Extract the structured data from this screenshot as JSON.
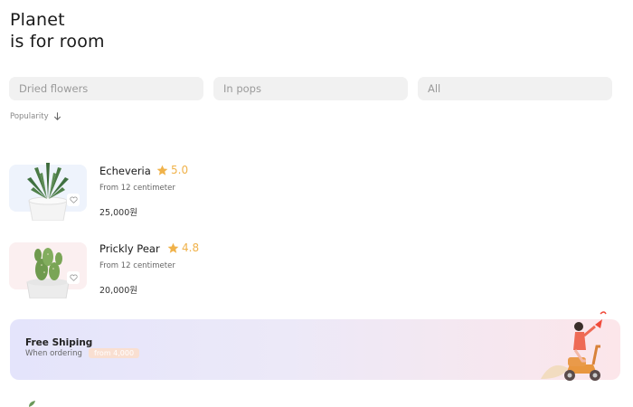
{
  "header": {
    "title_line1": "Planet",
    "title_line2": "is for room"
  },
  "filters": [
    {
      "label": "Dried flowers"
    },
    {
      "label": "In pops"
    },
    {
      "label": "All"
    }
  ],
  "sort": {
    "label": "Popularity",
    "icon": "arrow-down-icon"
  },
  "products": [
    {
      "name": "Echeveria",
      "rating": "5.0",
      "size": "From 12 centimeter",
      "price": "25,000원",
      "thumb_bg": "#eef3fc"
    },
    {
      "name": "Prickly Pear",
      "rating": "4.8",
      "size": "From 12 centimeter",
      "price": "20,000원",
      "thumb_bg": "#fbeff0"
    }
  ],
  "banner": {
    "title": "Free Shiping",
    "subtitle": "When ordering",
    "badge": "from 4,000"
  },
  "colors": {
    "star": "#f0b24a",
    "chip_bg": "#f1f1f1"
  }
}
